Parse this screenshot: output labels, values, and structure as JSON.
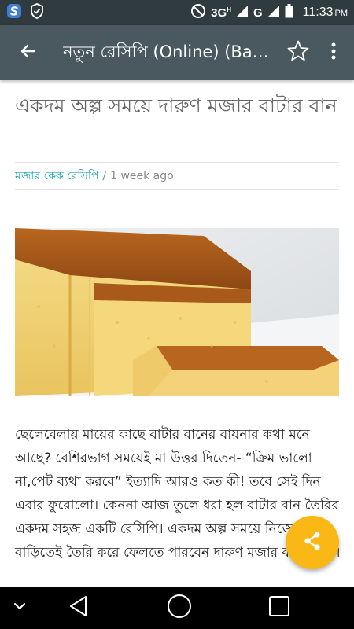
{
  "status_bar": {
    "network": "3G",
    "network_sup": "H",
    "network2": "G",
    "time": "11:33",
    "ampm": "PM",
    "icons": [
      "s-logo-icon",
      "shield-check-icon",
      "dnd-icon",
      "signal-icon",
      "battery-icon"
    ]
  },
  "app_bar": {
    "title": "নতুন রেসিপি (Online) (Bangla Recipe)",
    "back_icon": "arrow-left-icon",
    "star_icon": "star-outline-icon",
    "more_icon": "more-vertical-icon"
  },
  "article": {
    "title": "একদম অল্প সময়ে দারুণ মজার বাটার বান",
    "category": "মজার কেক রেসিপি",
    "separator": "/",
    "time_ago": "1 week ago",
    "image": "butter-cake-image",
    "body": "ছেলেবেলায় মায়ের কাছে বাটার বানের বায়নার কথা মনে আছে? বেশিরভাগ সময়েই মা উত্তর দিতেন- “ক্রিম ভালো না,পেট ব্যথা করবে” ইত্যাদি আরও কত কী! তবে সেই দিন এবার ফুরোলো। কেননা আজ তুলে ধরা হল বাটার বান তৈরির একদম সহজ একটি রেসিপি। একদম অল্প সময়ে নিজের বাড়িতেই তৈরি করে ফেলতে পারবেন দারুণ মজার বাটার বান।"
  },
  "fab": {
    "icon": "share-icon"
  },
  "nav_bar": {
    "icons": [
      "chevron-down-icon",
      "back-triangle-icon",
      "home-circle-icon",
      "recents-square-icon"
    ]
  },
  "colors": {
    "status_bar": "#2f3b3f",
    "app_bar": "#4a5960",
    "accent": "#1aa6b7",
    "fab": "#f9b815"
  }
}
